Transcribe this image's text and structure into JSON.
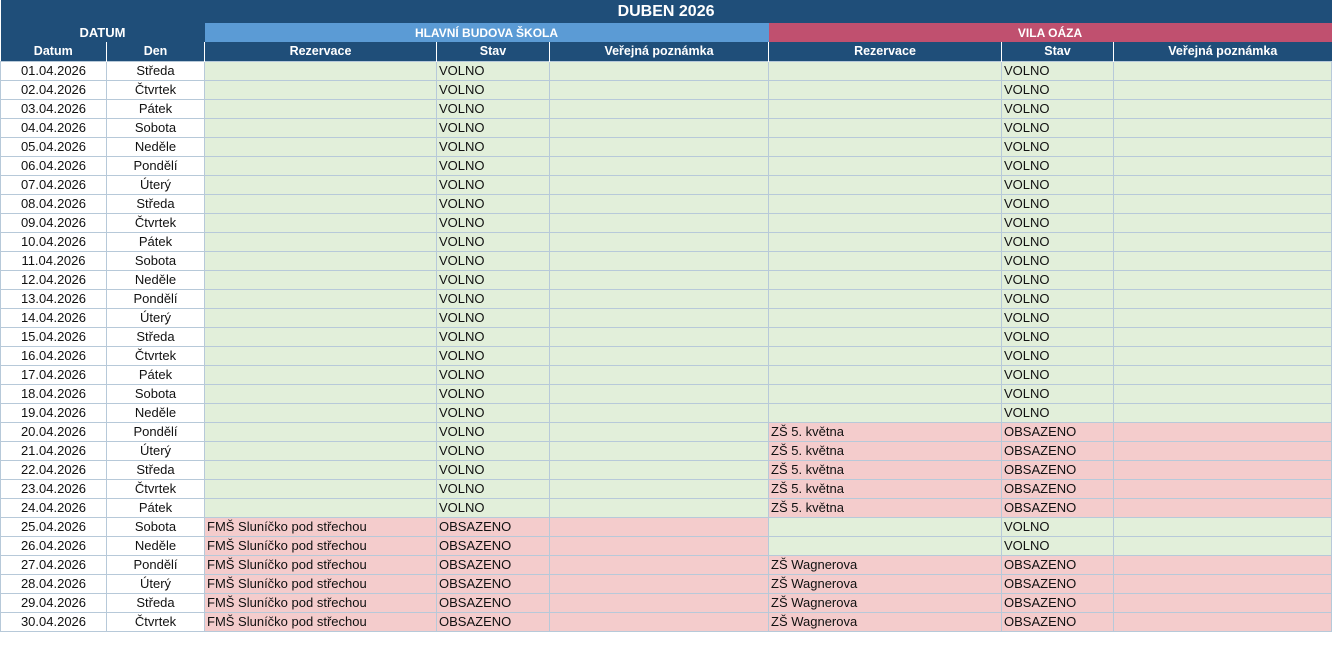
{
  "title": "DUBEN 2026",
  "groups": {
    "datum": "DATUM",
    "building_a": "HLAVNÍ BUDOVA ŠKOLA",
    "building_b": "VILA OÁZA"
  },
  "headers": {
    "datum": "Datum",
    "den": "Den",
    "rezervace": "Rezervace",
    "stav": "Stav",
    "poznamka": "Veřejná poznámka"
  },
  "colors": {
    "header": "#1f4e79",
    "building_a": "#5b9bd5",
    "building_b": "#c0506f",
    "free_bg": "#e2efda",
    "free_text": "#2e5c0e",
    "busy_bg": "#f4cccc",
    "busy_text": "#a61b1b"
  },
  "rows": [
    {
      "date": "01.04.2026",
      "day": "Středa",
      "a_res": "",
      "a_stav": "VOLNO",
      "a_note": "",
      "b_res": "",
      "b_stav": "VOLNO",
      "b_note": ""
    },
    {
      "date": "02.04.2026",
      "day": "Čtvrtek",
      "a_res": "",
      "a_stav": "VOLNO",
      "a_note": "",
      "b_res": "",
      "b_stav": "VOLNO",
      "b_note": ""
    },
    {
      "date": "03.04.2026",
      "day": "Pátek",
      "a_res": "",
      "a_stav": "VOLNO",
      "a_note": "",
      "b_res": "",
      "b_stav": "VOLNO",
      "b_note": ""
    },
    {
      "date": "04.04.2026",
      "day": "Sobota",
      "a_res": "",
      "a_stav": "VOLNO",
      "a_note": "",
      "b_res": "",
      "b_stav": "VOLNO",
      "b_note": ""
    },
    {
      "date": "05.04.2026",
      "day": "Neděle",
      "a_res": "",
      "a_stav": "VOLNO",
      "a_note": "",
      "b_res": "",
      "b_stav": "VOLNO",
      "b_note": ""
    },
    {
      "date": "06.04.2026",
      "day": "Pondělí",
      "a_res": "",
      "a_stav": "VOLNO",
      "a_note": "",
      "b_res": "",
      "b_stav": "VOLNO",
      "b_note": ""
    },
    {
      "date": "07.04.2026",
      "day": "Úterý",
      "a_res": "",
      "a_stav": "VOLNO",
      "a_note": "",
      "b_res": "",
      "b_stav": "VOLNO",
      "b_note": ""
    },
    {
      "date": "08.04.2026",
      "day": "Středa",
      "a_res": "",
      "a_stav": "VOLNO",
      "a_note": "",
      "b_res": "",
      "b_stav": "VOLNO",
      "b_note": ""
    },
    {
      "date": "09.04.2026",
      "day": "Čtvrtek",
      "a_res": "",
      "a_stav": "VOLNO",
      "a_note": "",
      "b_res": "",
      "b_stav": "VOLNO",
      "b_note": ""
    },
    {
      "date": "10.04.2026",
      "day": "Pátek",
      "a_res": "",
      "a_stav": "VOLNO",
      "a_note": "",
      "b_res": "",
      "b_stav": "VOLNO",
      "b_note": ""
    },
    {
      "date": "11.04.2026",
      "day": "Sobota",
      "a_res": "",
      "a_stav": "VOLNO",
      "a_note": "",
      "b_res": "",
      "b_stav": "VOLNO",
      "b_note": ""
    },
    {
      "date": "12.04.2026",
      "day": "Neděle",
      "a_res": "",
      "a_stav": "VOLNO",
      "a_note": "",
      "b_res": "",
      "b_stav": "VOLNO",
      "b_note": ""
    },
    {
      "date": "13.04.2026",
      "day": "Pondělí",
      "a_res": "",
      "a_stav": "VOLNO",
      "a_note": "",
      "b_res": "",
      "b_stav": "VOLNO",
      "b_note": ""
    },
    {
      "date": "14.04.2026",
      "day": "Úterý",
      "a_res": "",
      "a_stav": "VOLNO",
      "a_note": "",
      "b_res": "",
      "b_stav": "VOLNO",
      "b_note": ""
    },
    {
      "date": "15.04.2026",
      "day": "Středa",
      "a_res": "",
      "a_stav": "VOLNO",
      "a_note": "",
      "b_res": "",
      "b_stav": "VOLNO",
      "b_note": ""
    },
    {
      "date": "16.04.2026",
      "day": "Čtvrtek",
      "a_res": "",
      "a_stav": "VOLNO",
      "a_note": "",
      "b_res": "",
      "b_stav": "VOLNO",
      "b_note": ""
    },
    {
      "date": "17.04.2026",
      "day": "Pátek",
      "a_res": "",
      "a_stav": "VOLNO",
      "a_note": "",
      "b_res": "",
      "b_stav": "VOLNO",
      "b_note": ""
    },
    {
      "date": "18.04.2026",
      "day": "Sobota",
      "a_res": "",
      "a_stav": "VOLNO",
      "a_note": "",
      "b_res": "",
      "b_stav": "VOLNO",
      "b_note": ""
    },
    {
      "date": "19.04.2026",
      "day": "Neděle",
      "a_res": "",
      "a_stav": "VOLNO",
      "a_note": "",
      "b_res": "",
      "b_stav": "VOLNO",
      "b_note": ""
    },
    {
      "date": "20.04.2026",
      "day": "Pondělí",
      "a_res": "",
      "a_stav": "VOLNO",
      "a_note": "",
      "b_res": "ZŠ 5. května",
      "b_stav": "OBSAZENO",
      "b_note": ""
    },
    {
      "date": "21.04.2026",
      "day": "Úterý",
      "a_res": "",
      "a_stav": "VOLNO",
      "a_note": "",
      "b_res": "ZŠ 5. května",
      "b_stav": "OBSAZENO",
      "b_note": ""
    },
    {
      "date": "22.04.2026",
      "day": "Středa",
      "a_res": "",
      "a_stav": "VOLNO",
      "a_note": "",
      "b_res": "ZŠ 5. května",
      "b_stav": "OBSAZENO",
      "b_note": ""
    },
    {
      "date": "23.04.2026",
      "day": "Čtvrtek",
      "a_res": "",
      "a_stav": "VOLNO",
      "a_note": "",
      "b_res": "ZŠ 5. května",
      "b_stav": "OBSAZENO",
      "b_note": ""
    },
    {
      "date": "24.04.2026",
      "day": "Pátek",
      "a_res": "",
      "a_stav": "VOLNO",
      "a_note": "",
      "b_res": "ZŠ 5. května",
      "b_stav": "OBSAZENO",
      "b_note": ""
    },
    {
      "date": "25.04.2026",
      "day": "Sobota",
      "a_res": "FMŠ Sluníčko pod střechou",
      "a_stav": "OBSAZENO",
      "a_note": "",
      "b_res": "",
      "b_stav": "VOLNO",
      "b_note": ""
    },
    {
      "date": "26.04.2026",
      "day": "Neděle",
      "a_res": "FMŠ Sluníčko pod střechou",
      "a_stav": "OBSAZENO",
      "a_note": "",
      "b_res": "",
      "b_stav": "VOLNO",
      "b_note": ""
    },
    {
      "date": "27.04.2026",
      "day": "Pondělí",
      "a_res": "FMŠ Sluníčko pod střechou",
      "a_stav": "OBSAZENO",
      "a_note": "",
      "b_res": "ZŠ Wagnerova",
      "b_stav": "OBSAZENO",
      "b_note": ""
    },
    {
      "date": "28.04.2026",
      "day": "Úterý",
      "a_res": "FMŠ Sluníčko pod střechou",
      "a_stav": "OBSAZENO",
      "a_note": "",
      "b_res": "ZŠ Wagnerova",
      "b_stav": "OBSAZENO",
      "b_note": ""
    },
    {
      "date": "29.04.2026",
      "day": "Středa",
      "a_res": "FMŠ Sluníčko pod střechou",
      "a_stav": "OBSAZENO",
      "a_note": "",
      "b_res": "ZŠ Wagnerova",
      "b_stav": "OBSAZENO",
      "b_note": ""
    },
    {
      "date": "30.04.2026",
      "day": "Čtvrtek",
      "a_res": "FMŠ Sluníčko pod střechou",
      "a_stav": "OBSAZENO",
      "a_note": "",
      "b_res": "ZŠ Wagnerova",
      "b_stav": "OBSAZENO",
      "b_note": ""
    }
  ]
}
